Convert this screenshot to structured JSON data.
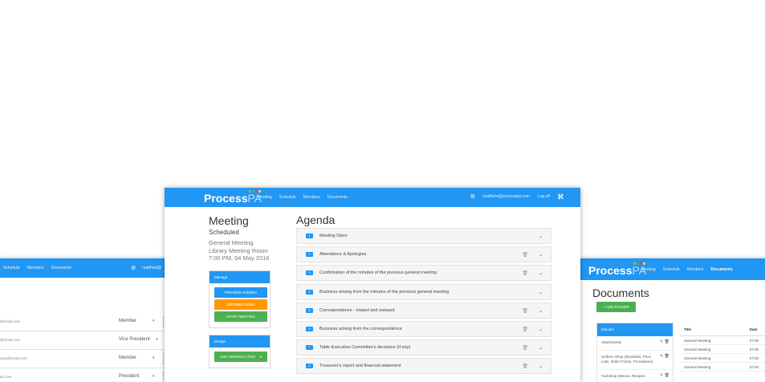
{
  "colors": {
    "primary": "#2196f3",
    "orange": "#ff9800",
    "green": "#4caf50"
  },
  "left_window": {
    "nav": [
      "Schedule",
      "Members",
      "Documents"
    ],
    "gear_icon": "gear-icon",
    "user_email_fragment": "matthew@",
    "rows": [
      {
        "email": "@email.com",
        "role": "Member",
        "has_caret": true
      },
      {
        "email": "@email.com",
        "role": "Vice President",
        "has_caret": true
      },
      {
        "email": "sam@email.com",
        "role": "Member",
        "has_caret": true
      },
      {
        "email": "ail.com",
        "role": "President",
        "has_caret": true
      }
    ]
  },
  "center_window": {
    "logo": {
      "main": "Process",
      "suffix": "PA"
    },
    "nav": [
      "Meeting",
      "Schedule",
      "Members",
      "Documents"
    ],
    "user_email": "matthew@processpa.com",
    "logoff": "Log off",
    "meeting": {
      "title": "Meeting",
      "status": "Scheduled",
      "type": "General Meeting",
      "location": "Library Meeting Room",
      "datetime": "7:00 PM, 04 May 2016"
    },
    "manage_panel": {
      "heading": "Manage",
      "buttons": [
        "PREVIEW AGENDA",
        "DISTRIBUTIONS",
        "START MEETING"
      ]
    },
    "design_panel": {
      "heading": "Design",
      "button": "ADD GENERAL ITEM"
    },
    "agenda": {
      "title": "Agenda",
      "items": [
        {
          "num": "1",
          "label": "Meeting Open",
          "trash": false
        },
        {
          "num": "2",
          "label": "Attendance & Apologies",
          "trash": true
        },
        {
          "num": "3",
          "label": "Confirmation of the minutes of the previous general meeting",
          "trash": true
        },
        {
          "num": "4",
          "label": "Business arising from the minutes of the previous general meeting",
          "trash": false
        },
        {
          "num": "5",
          "label": "Correspondence - inward and outward",
          "trash": true
        },
        {
          "num": "6",
          "label": "Business arising from the correspondence",
          "trash": true
        },
        {
          "num": "7",
          "label": "Table Executive Committee's decisions (if any)",
          "trash": true
        },
        {
          "num": "8",
          "label": "Treasurer's report and financial statement",
          "trash": true
        }
      ]
    }
  },
  "right_window": {
    "logo": {
      "main": "Process",
      "suffix": "PA"
    },
    "nav": [
      "Meeting",
      "Schedule",
      "Members",
      "Documents"
    ],
    "active_nav": "Documents",
    "title": "Documents",
    "add_folder": "+ ADD FOLDER",
    "folders_heading": "Minutes",
    "folders": [
      {
        "name": "Attachments",
        "icons": true
      },
      {
        "name": "Uniform Shop (Stocklists, Price Lists, Order Forms, Procedures)",
        "icons": true
      },
      {
        "name": "Tuckshop (Menus, Recipes",
        "icons": true
      }
    ],
    "table": {
      "headers": [
        "Title",
        "Date"
      ],
      "rows": [
        [
          "General Meeting",
          "07:00"
        ],
        [
          "General Meeting",
          "07:00"
        ],
        [
          "General Meeting",
          "07:00"
        ],
        [
          "General Meeting",
          "07:00"
        ]
      ]
    }
  }
}
